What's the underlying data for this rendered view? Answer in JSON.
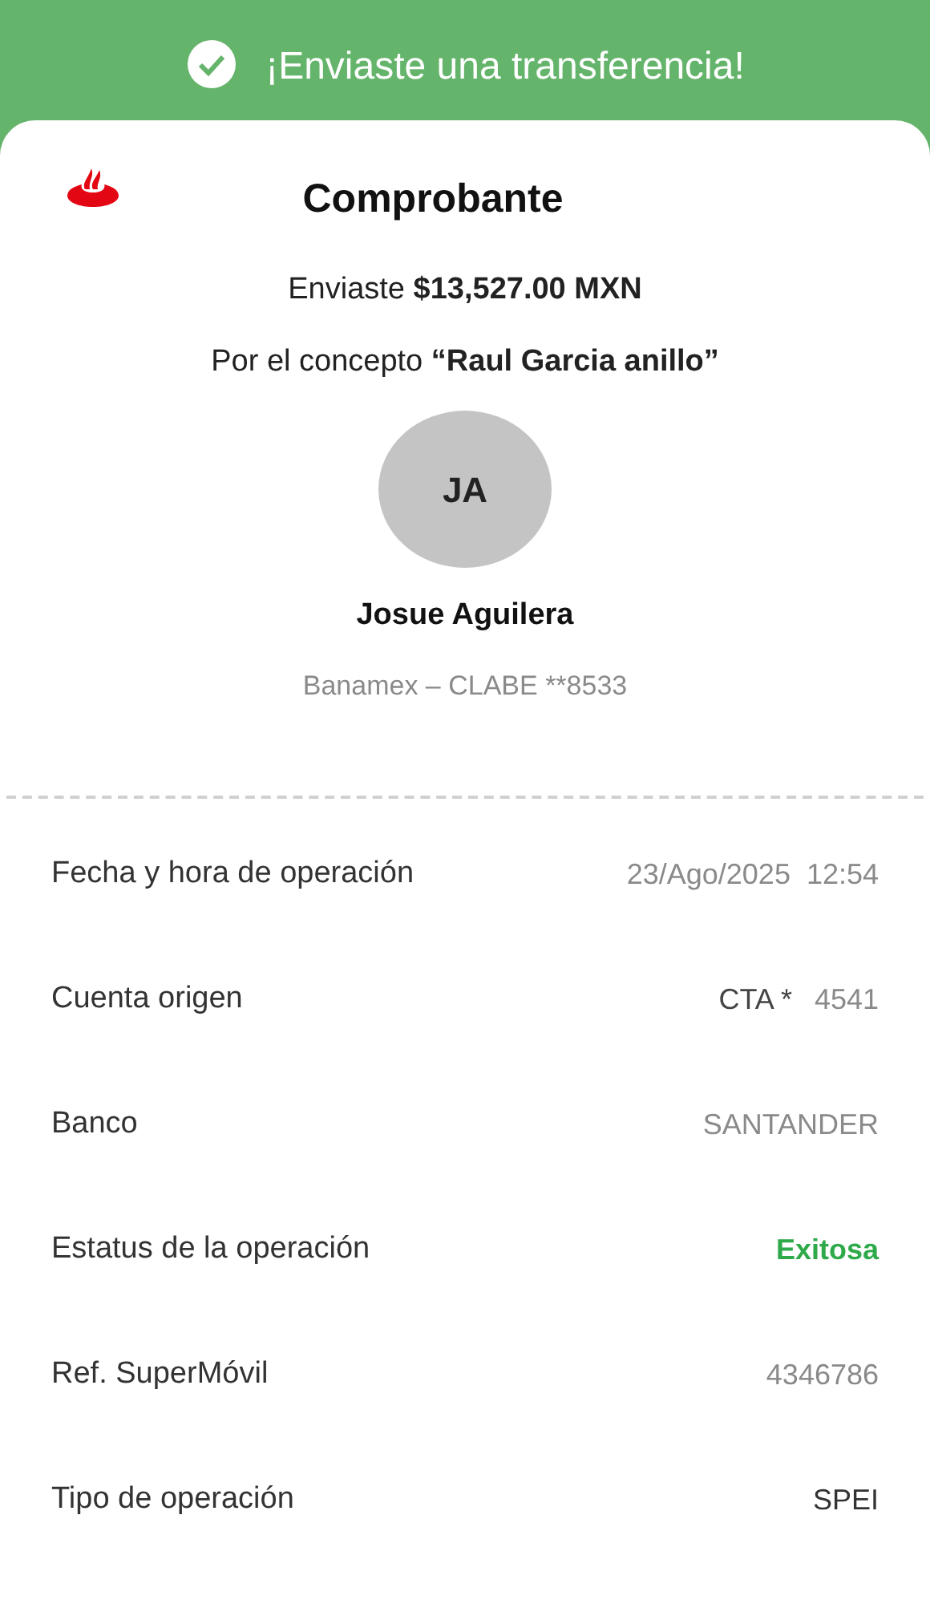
{
  "banner": {
    "title": "¡Enviaste una transferencia!"
  },
  "receipt": {
    "title": "Comprobante",
    "amount_line": "Enviaste **$13,527.00 MXN**",
    "concept_line": "Por el concepto **“Raul Garcia anillo”**",
    "recipient": {
      "initials": "JA",
      "name": "Josue Aguilera",
      "bank": "Banamex – CLABE **8533"
    }
  },
  "details": [
    {
      "label": "Fecha y hora de operación",
      "kind": "plain",
      "value": "23/Ago/2025  12:54"
    },
    {
      "label": "Cuenta origen",
      "kind": "account",
      "prefix": "CTA *",
      "value": "4541"
    },
    {
      "label": "Banco",
      "kind": "plain",
      "value": "SANTANDER"
    },
    {
      "label": "Estatus de la operación",
      "kind": "status",
      "value": "Exitosa"
    },
    {
      "label": "Ref. SuperMóvil",
      "kind": "plain",
      "value": "4346786"
    },
    {
      "label": "Tipo de operación",
      "kind": "dark",
      "value": "SPEI"
    }
  ]
}
